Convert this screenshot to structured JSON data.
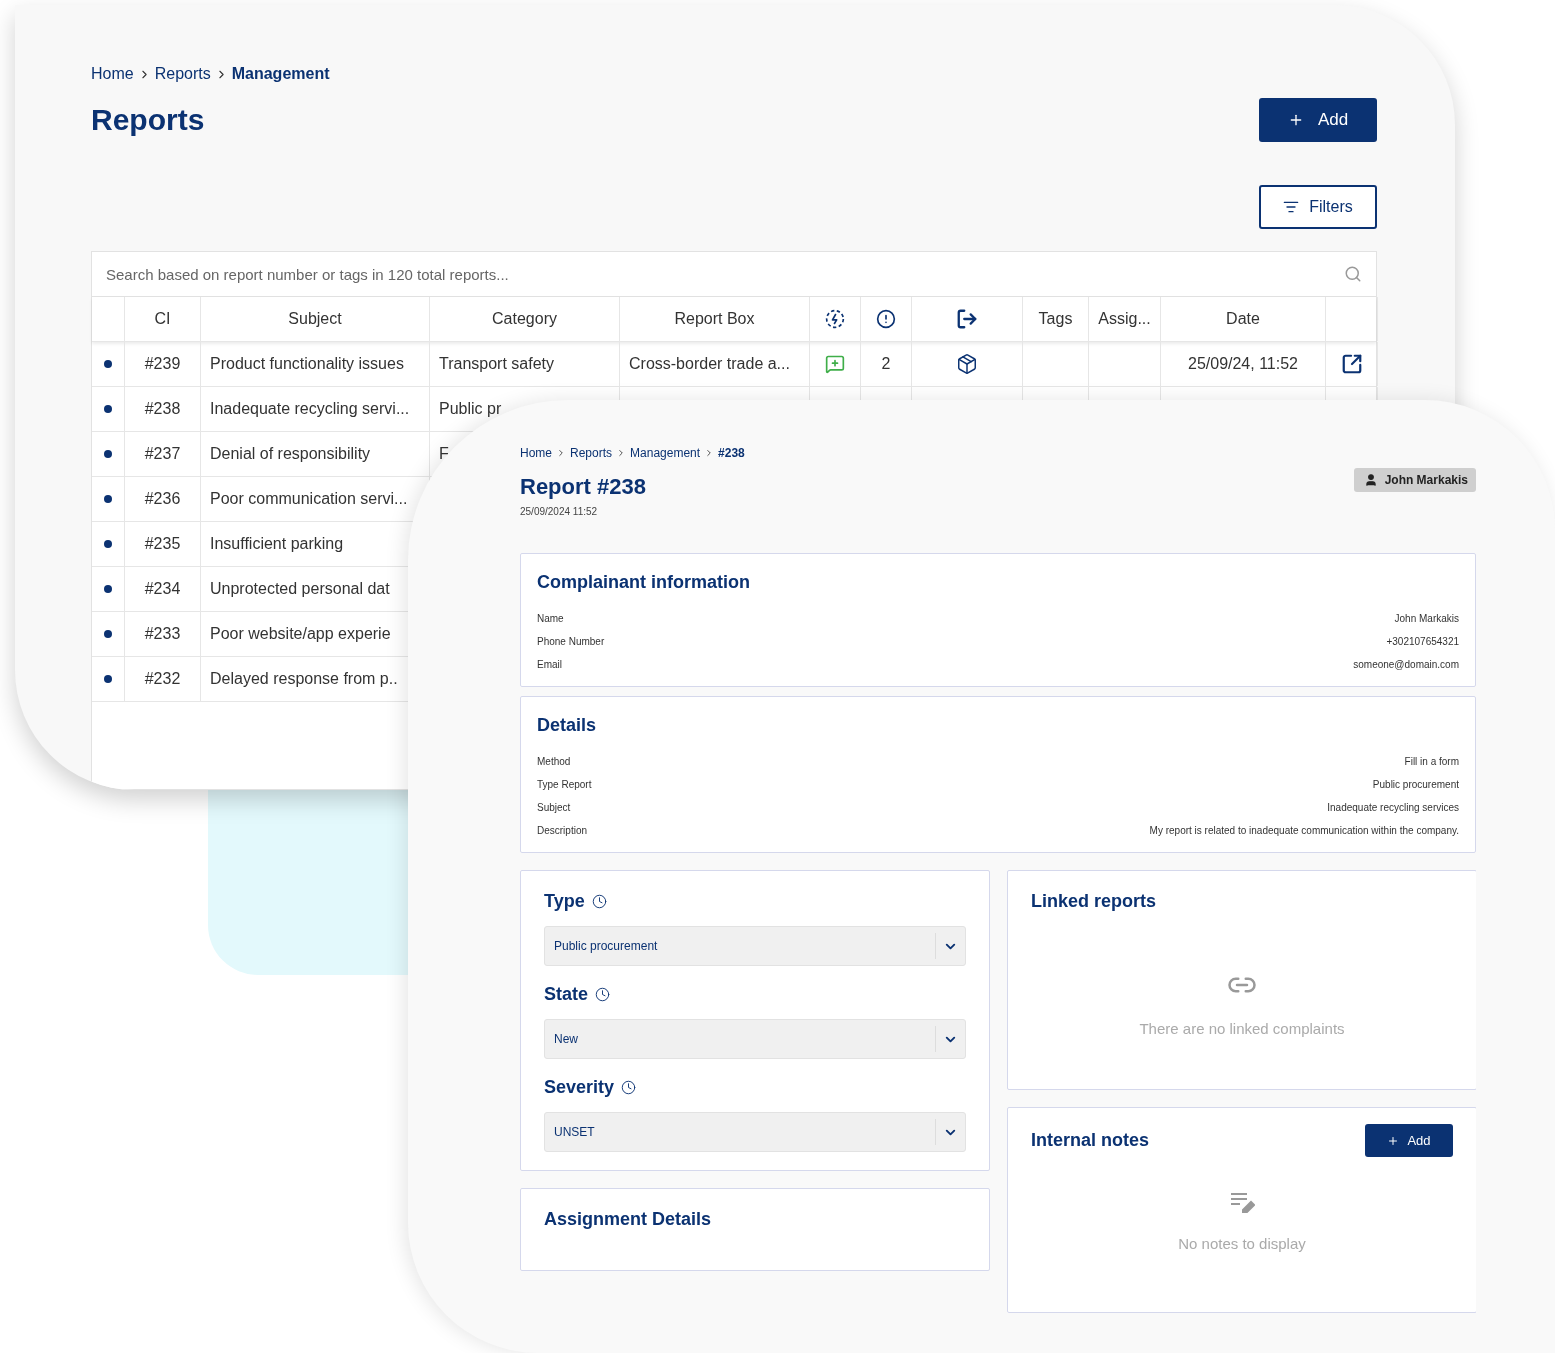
{
  "list_screen": {
    "breadcrumb": [
      "Home",
      "Reports",
      "Management"
    ],
    "title": "Reports",
    "add_button": "Add",
    "filters_button": "Filters",
    "search": {
      "placeholder": "Search based on report number or tags in 120 total reports..."
    },
    "columns": [
      {
        "kind": "blank"
      },
      {
        "kind": "text",
        "label": "CI"
      },
      {
        "kind": "text",
        "label": "Subject"
      },
      {
        "kind": "text",
        "label": "Category"
      },
      {
        "kind": "text",
        "label": "Report Box"
      },
      {
        "kind": "icon"
      },
      {
        "kind": "icon"
      },
      {
        "kind": "icon"
      },
      {
        "kind": "text",
        "label": "Tags"
      },
      {
        "kind": "text",
        "label": "Assig..."
      },
      {
        "kind": "text",
        "label": "Date"
      },
      {
        "kind": "blank"
      }
    ],
    "rows": [
      {
        "unread": true,
        "ci": "#239",
        "subject": "Product functionality issues",
        "category": "Transport safety",
        "report_box": "Cross-border trade a...",
        "count": "2",
        "date": "25/09/24, 11:52"
      },
      {
        "unread": true,
        "ci": "#238",
        "subject": "Inadequate recycling servi...",
        "category": "Public pr"
      },
      {
        "unread": true,
        "ci": "#237",
        "subject": "Denial of responsibility",
        "category": "F"
      },
      {
        "unread": true,
        "ci": "#236",
        "subject": "Poor communication servi..."
      },
      {
        "unread": true,
        "ci": "#235",
        "subject": "Insufficient parking"
      },
      {
        "unread": true,
        "ci": "#234",
        "subject": "Unprotected personal dat"
      },
      {
        "unread": true,
        "ci": "#233",
        "subject": "Poor website/app experie"
      },
      {
        "unread": true,
        "ci": "#232",
        "subject": "Delayed response from p.."
      }
    ]
  },
  "detail_screen": {
    "breadcrumb": [
      "Home",
      "Reports",
      "Management",
      "#238"
    ],
    "title": "Report #238",
    "date": "25/09/2024 11:52",
    "assignee": "John Markakis",
    "complainant": {
      "title": "Complainant information",
      "fields": [
        {
          "label": "Name",
          "value": "John Markakis"
        },
        {
          "label": "Phone Number",
          "value": "+302107654321"
        },
        {
          "label": "Email",
          "value": "someone@domain.com"
        }
      ]
    },
    "details": {
      "title": "Details",
      "fields": [
        {
          "label": "Method",
          "value": "Fill in a form"
        },
        {
          "label": "Type Report",
          "value": "Public procurement"
        },
        {
          "label": "Subject",
          "value": "Inadequate recycling services"
        },
        {
          "label": "Description",
          "value": "My report is related to inadequate communication within the company."
        }
      ]
    },
    "selects": [
      {
        "label": "Type",
        "value": "Public procurement"
      },
      {
        "label": "State",
        "value": "New"
      },
      {
        "label": "Severity",
        "value": "UNSET"
      }
    ],
    "assignment": {
      "title": "Assignment Details"
    },
    "linked_reports": {
      "title": "Linked reports",
      "empty": "There are no linked complaints"
    },
    "internal_notes": {
      "title": "Internal notes",
      "add_button": "Add",
      "empty": "No notes to display"
    }
  }
}
